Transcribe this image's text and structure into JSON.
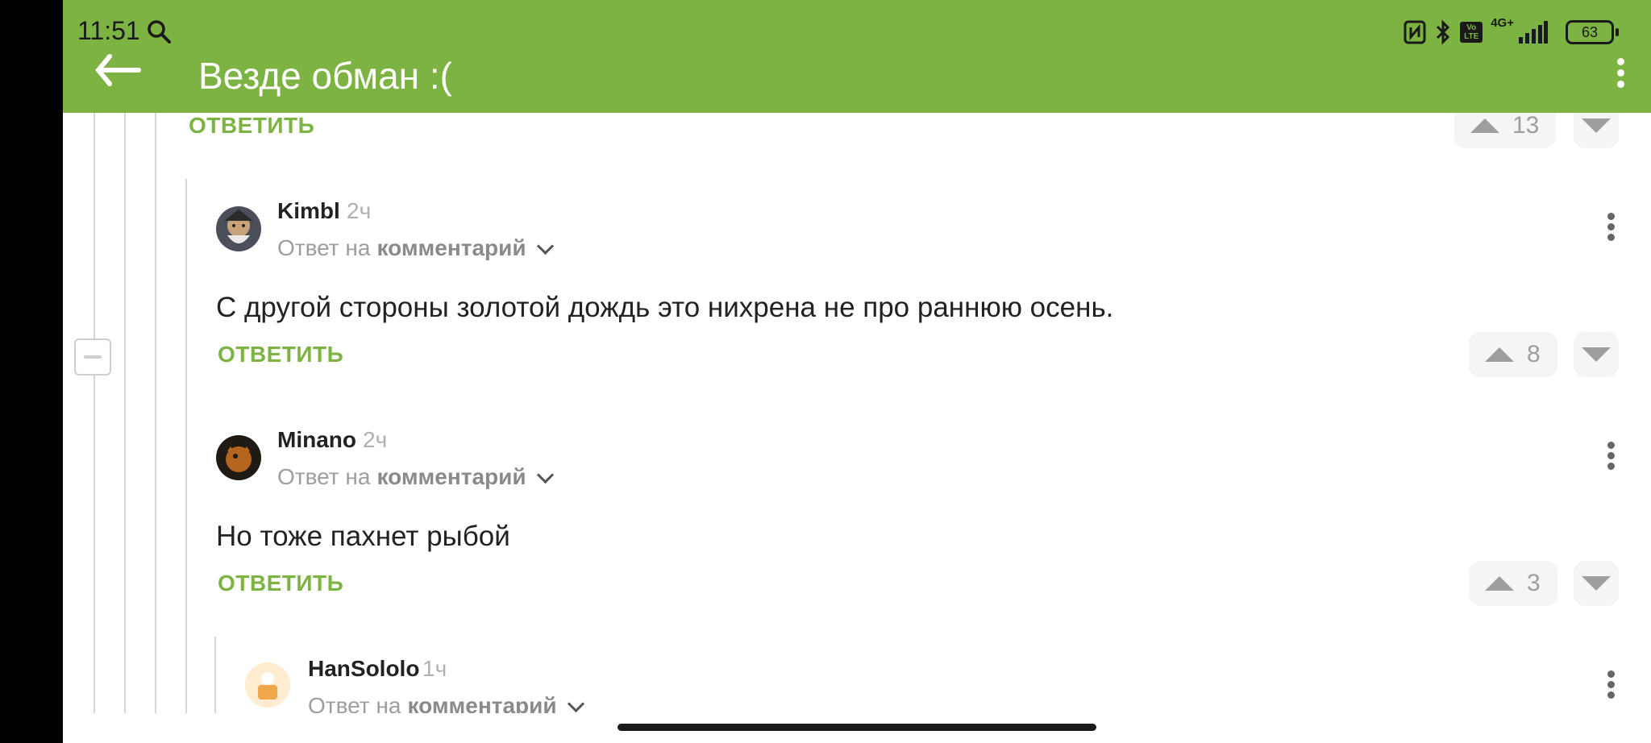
{
  "status": {
    "time": "11:51",
    "network": "4G+",
    "volte": "Vo LTE",
    "battery": "63"
  },
  "header": {
    "title": "Везде обман :("
  },
  "top_comment": {
    "reply_label": "ОТВЕТИТЬ",
    "score": "13"
  },
  "comments": [
    {
      "author": "Kimbl",
      "time": "2ч",
      "reply_prefix": "Ответ на",
      "reply_target": "комментарий",
      "text": "С другой стороны золотой дождь это нихрена не про раннюю осень.",
      "reply_label": "ОТВЕТИТЬ",
      "score": "8"
    },
    {
      "author": "Minano",
      "time": "2ч",
      "reply_prefix": "Ответ на",
      "reply_target": "комментарий",
      "text": "Но тоже пахнет рыбой",
      "reply_label": "ОТВЕТИТЬ",
      "score": "3"
    },
    {
      "author": "HanSololo",
      "time": "1ч",
      "reply_prefix": "Ответ на",
      "reply_target": "комментарий"
    }
  ],
  "colors": {
    "accent": "#7cb342",
    "text": "#222222",
    "muted": "#9e9e9e"
  }
}
